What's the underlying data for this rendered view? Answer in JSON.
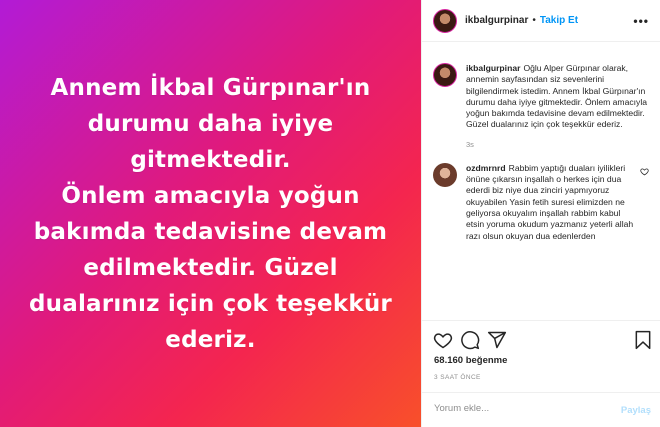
{
  "post": {
    "image_text": "Annem İkbal Gürpınar'ın\ndurumu daha iyiye\ngitmektedir.\nÖnlem amacıyla yoğun\nbakımda tedavisine devam\nedilmektedir. Güzel\ndualarınız için çok teşekkür\nederiz.",
    "gradient_colors": [
      "#b21bd6",
      "#e11a7a",
      "#f4254f",
      "#f8502a"
    ]
  },
  "header": {
    "username": "ikbalgurpinar",
    "separator": "•",
    "follow_label": "Takip Et",
    "more_label": "•••"
  },
  "comments": [
    {
      "username": "ikbalgurpinar",
      "text": "Oğlu Alper Gürpınar olarak, annemin sayfasından siz sevenlerini bilgilendirmek istedim. Annem İkbal Gürpınar'ın durumu daha iyiye gitmektedir. Önlem amacıyla yoğun bakımda tedavisine devam edilmektedir. Güzel dualarınız için çok teşekkür ederiz.",
      "time": "3s"
    },
    {
      "username": "ozdmrnrd",
      "text": "Rabbim yaptığı duaları iyilikleri önüne çıkarsın inşallah o herkes için dua ederdi biz niye dua zinciri yapmıyoruz okuyabilen Yasin fetih suresi elimizden ne geliyorsa okuyalım inşallah rabbim kabul etsin yoruma okudum yazmanız yeterli allah razı olsun okuyan dua edenlerden"
    }
  ],
  "actions": {
    "icons": [
      "heart-icon",
      "comment-icon",
      "share-icon",
      "bookmark-icon"
    ],
    "likes": "68.160 beğenme",
    "time_ago": "3 SAAT ÖNCE"
  },
  "add_comment": {
    "placeholder": "Yorum ekle...",
    "post_label": "Paylaş"
  },
  "colors": {
    "accent": "#0095f6",
    "post_disabled": "#b2dffc",
    "muted": "#8e8e8e",
    "text": "#262626"
  }
}
